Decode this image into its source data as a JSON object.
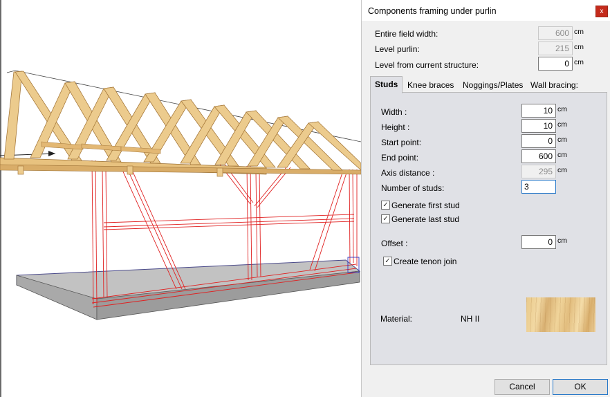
{
  "dialog": {
    "title": "Components framing under purlin",
    "close_label": "x",
    "top_fields": [
      {
        "label": "Entire field width:",
        "value": "600",
        "unit": "cm",
        "disabled": true
      },
      {
        "label": "Level purlin:",
        "value": "215",
        "unit": "cm",
        "disabled": true
      },
      {
        "label": "Level from current structure:",
        "value": "0",
        "unit": "cm",
        "disabled": false
      }
    ],
    "tabs": [
      {
        "label": "Studs",
        "active": true
      },
      {
        "label": "Knee braces",
        "active": false
      },
      {
        "label": "Noggings/Plates",
        "active": false
      },
      {
        "label": "Wall bracing:",
        "active": false
      }
    ],
    "studs": {
      "width": {
        "label": "Width :",
        "value": "10",
        "unit": "cm"
      },
      "height": {
        "label": "Height :",
        "value": "10",
        "unit": "cm"
      },
      "start_point": {
        "label": "Start point:",
        "value": "0",
        "unit": "cm"
      },
      "end_point": {
        "label": "End point:",
        "value": "600",
        "unit": "cm"
      },
      "axis_distance": {
        "label": "Axis distance :",
        "value": "295",
        "unit": "cm"
      },
      "number_of_studs": {
        "label": "Number of studs:",
        "value": "3"
      },
      "generate_first_stud": {
        "label": "Generate first stud",
        "checked": true,
        "mark": "✓"
      },
      "generate_last_stud": {
        "label": "Generate last stud",
        "checked": true,
        "mark": "✓"
      },
      "offset": {
        "label": "Offset :",
        "value": "0",
        "unit": "cm"
      },
      "create_tenon_join": {
        "label": "Create tenon join",
        "checked": true,
        "mark": "✓"
      },
      "material": {
        "label": "Material:",
        "value": "NH II",
        "texture": "wood-texture-swatch"
      }
    },
    "buttons": {
      "cancel": "Cancel",
      "ok": "OK"
    }
  },
  "colors": {
    "dialog_bg": "#f0f0f0",
    "panel_bg": "#e0e1e6",
    "close_red": "#c42b1c",
    "timber": "#e8c27f",
    "timber_dark": "#b98a45",
    "wireframe_red": "#e02020",
    "slab_gray": "#c4c4c4"
  }
}
